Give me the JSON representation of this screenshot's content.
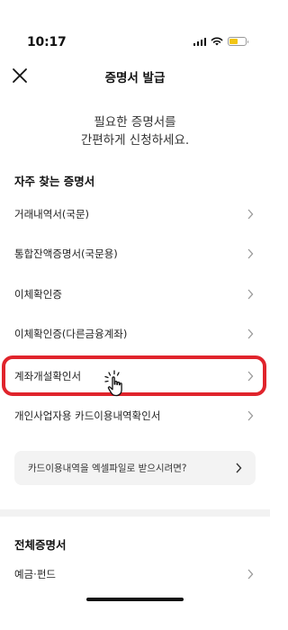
{
  "status_bar": {
    "time": "10:17"
  },
  "nav": {
    "title": "증명서 발급",
    "close_icon": "close-icon"
  },
  "intro": {
    "line1": "필요한 증명서를",
    "line2": "간편하게 신청하세요."
  },
  "frequent": {
    "title": "자주 찾는 증명서",
    "items": [
      {
        "label": "거래내역서(국문)"
      },
      {
        "label": "통합잔액증명서(국문용)"
      },
      {
        "label": "이체확인증"
      },
      {
        "label": "이체확인증(다른금융계좌)"
      },
      {
        "label": "계좌개설확인서"
      },
      {
        "label": "개인사업자용 카드이용내역확인서"
      }
    ]
  },
  "banner": {
    "label": "카드이용내역을 엑셀파일로 받으시려면?"
  },
  "all": {
    "title": "전체증명서",
    "items": [
      {
        "label": "예금·펀드"
      }
    ]
  },
  "colors": {
    "highlight": "#e0242c",
    "battery": "#f2c514",
    "banner_bg": "#f3f3f3"
  }
}
